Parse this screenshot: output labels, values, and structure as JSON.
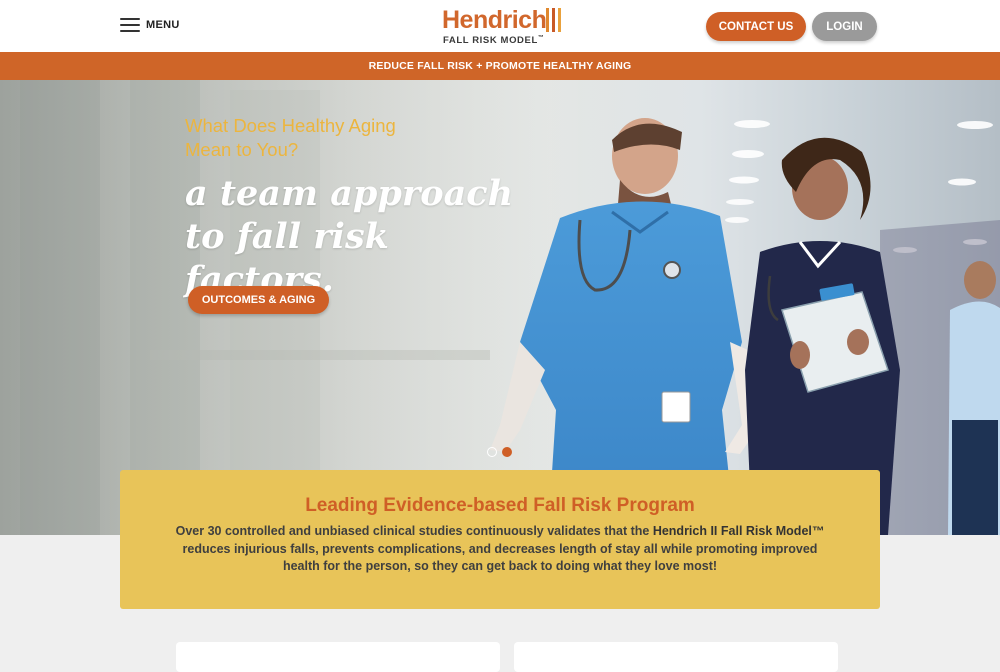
{
  "header": {
    "menu_label": "MENU",
    "logo_word": "Hendrich",
    "logo_sub": "FALL RISK MODEL",
    "logo_tm": "™",
    "contact_label": "CONTACT US",
    "login_label": "LOGIN"
  },
  "banner": {
    "text": "REDUCE FALL RISK + PROMOTE HEALTHY AGING"
  },
  "hero": {
    "eyebrow": "What Does Healthy Aging Mean to You?",
    "title": "a team approach to fall risk factors.",
    "cta_label": "OUTCOMES & AGING",
    "slides_total": 2,
    "slide_active": 2
  },
  "info": {
    "title": "Leading Evidence-based Fall Risk Program",
    "body_lead": "Over 30 controlled and unbiased clinical studies continuously validates that the ",
    "body_strong": "Hendrich II Fall Risk Model™",
    "body_tail": " reduces injurious falls, prevents complications, and decreases length of stay all while promoting improved health for the person, so they can get back to doing what they love most!"
  },
  "colors": {
    "brand_orange": "#cf5f26",
    "accent_yellow": "#e8c459",
    "eyebrow_yellow": "#ecb53e",
    "button_gray": "#9a9a9a"
  }
}
